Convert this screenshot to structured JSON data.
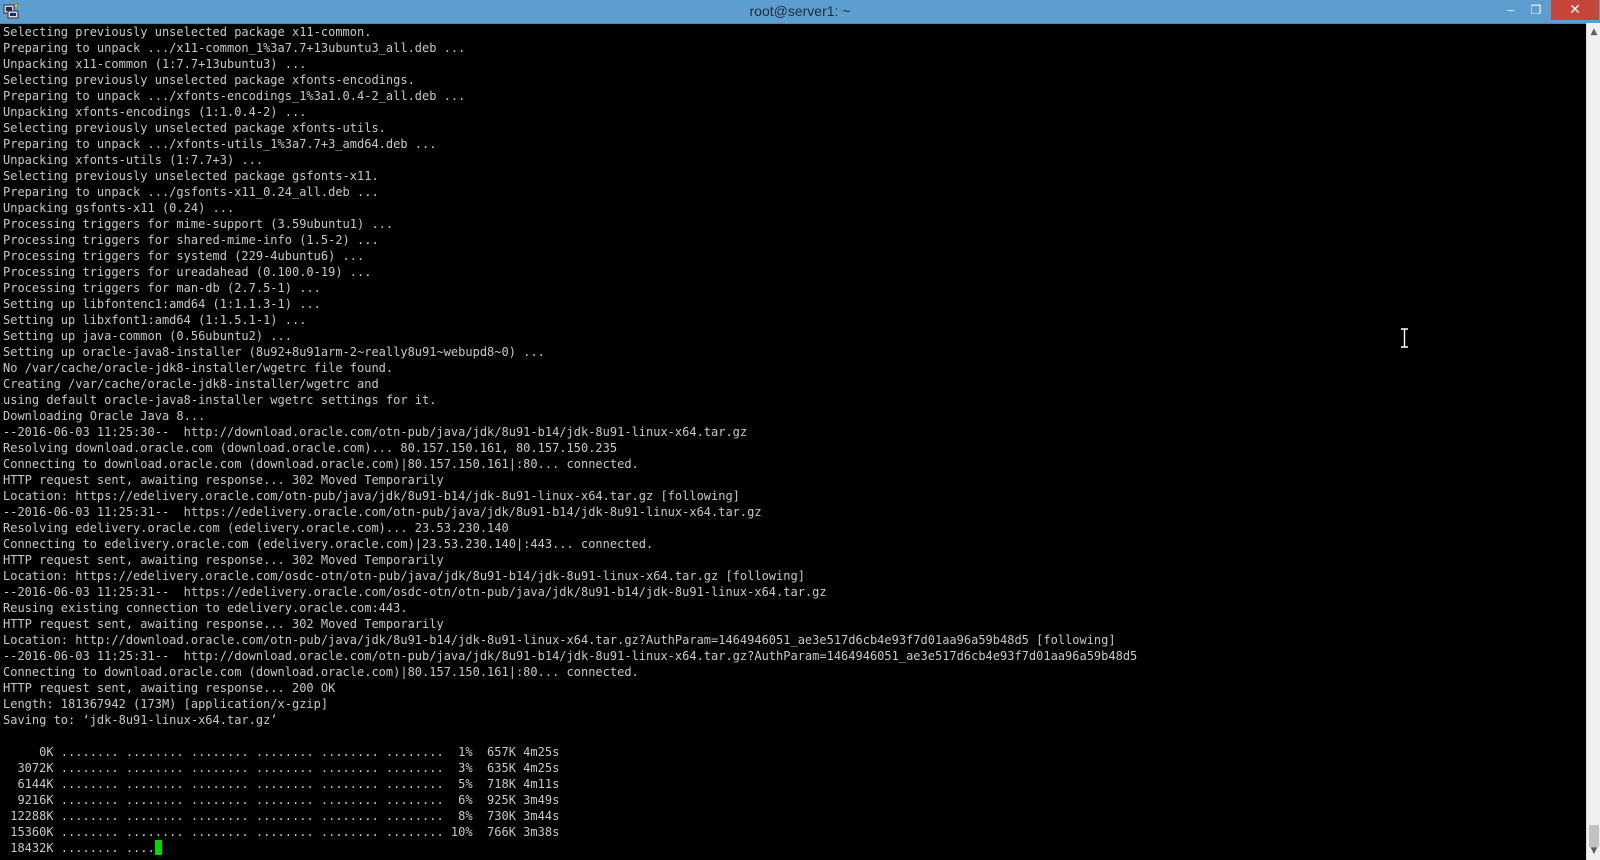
{
  "window": {
    "title": "root@server1: ~",
    "controls": {
      "minimize": "‒",
      "maximize": "❐",
      "close": "✕"
    }
  },
  "colors": {
    "titlebar": "#5b9ecf",
    "terminal_bg": "#000000",
    "terminal_fg": "#c8c8c8",
    "cursor": "#00d900",
    "close_button": "#c7463a"
  },
  "terminal": {
    "lines": [
      "Selecting previously unselected package x11-common.",
      "Preparing to unpack .../x11-common_1%3a7.7+13ubuntu3_all.deb ...",
      "Unpacking x11-common (1:7.7+13ubuntu3) ...",
      "Selecting previously unselected package xfonts-encodings.",
      "Preparing to unpack .../xfonts-encodings_1%3a1.0.4-2_all.deb ...",
      "Unpacking xfonts-encodings (1:1.0.4-2) ...",
      "Selecting previously unselected package xfonts-utils.",
      "Preparing to unpack .../xfonts-utils_1%3a7.7+3_amd64.deb ...",
      "Unpacking xfonts-utils (1:7.7+3) ...",
      "Selecting previously unselected package gsfonts-x11.",
      "Preparing to unpack .../gsfonts-x11_0.24_all.deb ...",
      "Unpacking gsfonts-x11 (0.24) ...",
      "Processing triggers for mime-support (3.59ubuntu1) ...",
      "Processing triggers for shared-mime-info (1.5-2) ...",
      "Processing triggers for systemd (229-4ubuntu6) ...",
      "Processing triggers for ureadahead (0.100.0-19) ...",
      "Processing triggers for man-db (2.7.5-1) ...",
      "Setting up libfontenc1:amd64 (1:1.1.3-1) ...",
      "Setting up libxfont1:amd64 (1:1.5.1-1) ...",
      "Setting up java-common (0.56ubuntu2) ...",
      "Setting up oracle-java8-installer (8u92+8u91arm-2~really8u91~webupd8~0) ...",
      "No /var/cache/oracle-jdk8-installer/wgetrc file found.",
      "Creating /var/cache/oracle-jdk8-installer/wgetrc and",
      "using default oracle-java8-installer wgetrc settings for it.",
      "Downloading Oracle Java 8...",
      "--2016-06-03 11:25:30--  http://download.oracle.com/otn-pub/java/jdk/8u91-b14/jdk-8u91-linux-x64.tar.gz",
      "Resolving download.oracle.com (download.oracle.com)... 80.157.150.161, 80.157.150.235",
      "Connecting to download.oracle.com (download.oracle.com)|80.157.150.161|:80... connected.",
      "HTTP request sent, awaiting response... 302 Moved Temporarily",
      "Location: https://edelivery.oracle.com/otn-pub/java/jdk/8u91-b14/jdk-8u91-linux-x64.tar.gz [following]",
      "--2016-06-03 11:25:31--  https://edelivery.oracle.com/otn-pub/java/jdk/8u91-b14/jdk-8u91-linux-x64.tar.gz",
      "Resolving edelivery.oracle.com (edelivery.oracle.com)... 23.53.230.140",
      "Connecting to edelivery.oracle.com (edelivery.oracle.com)|23.53.230.140|:443... connected.",
      "HTTP request sent, awaiting response... 302 Moved Temporarily",
      "Location: https://edelivery.oracle.com/osdc-otn/otn-pub/java/jdk/8u91-b14/jdk-8u91-linux-x64.tar.gz [following]",
      "--2016-06-03 11:25:31--  https://edelivery.oracle.com/osdc-otn/otn-pub/java/jdk/8u91-b14/jdk-8u91-linux-x64.tar.gz",
      "Reusing existing connection to edelivery.oracle.com:443.",
      "HTTP request sent, awaiting response... 302 Moved Temporarily",
      "Location: http://download.oracle.com/otn-pub/java/jdk/8u91-b14/jdk-8u91-linux-x64.tar.gz?AuthParam=1464946051_ae3e517d6cb4e93f7d01aa96a59b48d5 [following]",
      "--2016-06-03 11:25:31--  http://download.oracle.com/otn-pub/java/jdk/8u91-b14/jdk-8u91-linux-x64.tar.gz?AuthParam=1464946051_ae3e517d6cb4e93f7d01aa96a59b48d5",
      "Connecting to download.oracle.com (download.oracle.com)|80.157.150.161|:80... connected.",
      "HTTP request sent, awaiting response... 200 OK",
      "Length: 181367942 (173M) [application/x-gzip]",
      "Saving to: ‘jdk-8u91-linux-x64.tar.gz’",
      "",
      "     0K ........ ........ ........ ........ ........ ........  1%  657K 4m25s",
      "  3072K ........ ........ ........ ........ ........ ........  3%  635K 4m25s",
      "  6144K ........ ........ ........ ........ ........ ........  5%  718K 4m11s",
      "  9216K ........ ........ ........ ........ ........ ........  6%  925K 3m49s",
      " 12288K ........ ........ ........ ........ ........ ........  8%  730K 3m44s",
      " 15360K ........ ........ ........ ........ ........ ........ 10%  766K 3m38s"
    ],
    "current_line": " 18432K ........ ...."
  }
}
